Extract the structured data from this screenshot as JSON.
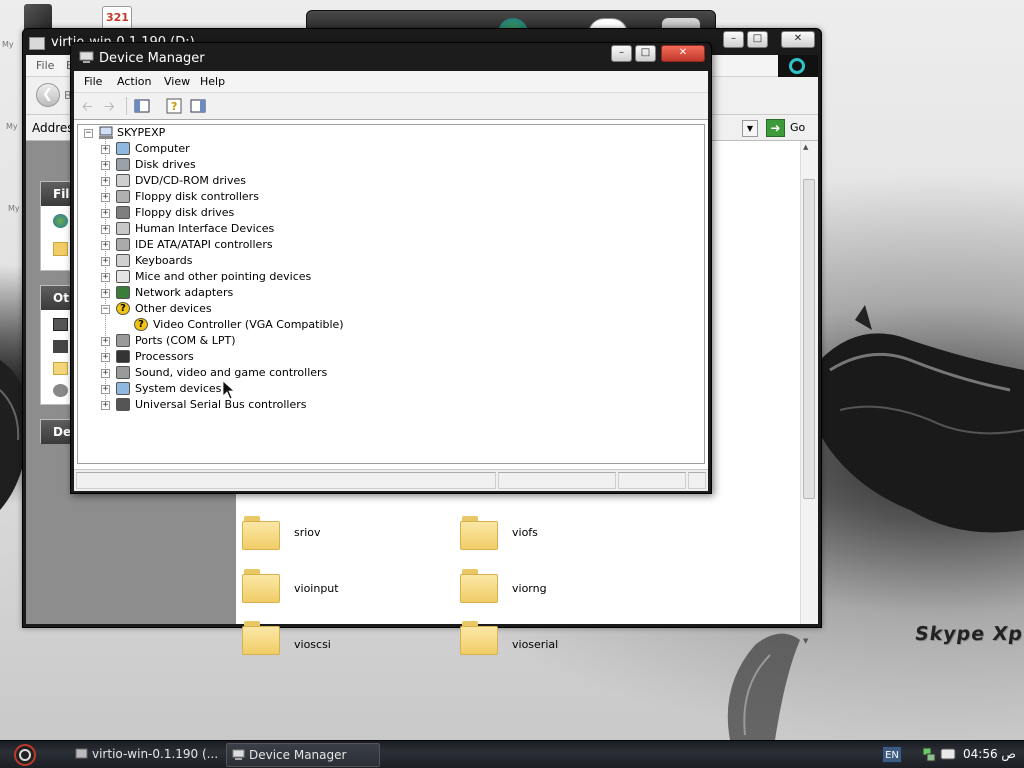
{
  "desktop": {
    "brand_text": "Skype Xp"
  },
  "explorer": {
    "title": "virtio-win-0.1.190 (D:)",
    "menu": [
      "File",
      "E"
    ],
    "back_label": "B",
    "address_label": "Address",
    "go_label": "Go",
    "task_headers": [
      "File",
      "Oth",
      "Det"
    ],
    "folders": [
      "sriov",
      "viofs",
      "vioinput",
      "viorng",
      "vioscsi",
      "vioserial"
    ]
  },
  "device_manager": {
    "title": "Device Manager",
    "menu": [
      "File",
      "Action",
      "View",
      "Help"
    ],
    "root": "SKYPEXP",
    "categories": [
      {
        "label": "Computer",
        "icon": "computer-icon",
        "expanded": false
      },
      {
        "label": "Disk drives",
        "icon": "disk-drive-icon",
        "expanded": false
      },
      {
        "label": "DVD/CD-ROM drives",
        "icon": "cdrom-icon",
        "expanded": false
      },
      {
        "label": "Floppy disk controllers",
        "icon": "floppy-controller-icon",
        "expanded": false
      },
      {
        "label": "Floppy disk drives",
        "icon": "floppy-drive-icon",
        "expanded": false
      },
      {
        "label": "Human Interface Devices",
        "icon": "hid-icon",
        "expanded": false
      },
      {
        "label": "IDE ATA/ATAPI controllers",
        "icon": "ide-controller-icon",
        "expanded": false
      },
      {
        "label": "Keyboards",
        "icon": "keyboard-icon",
        "expanded": false
      },
      {
        "label": "Mice and other pointing devices",
        "icon": "mouse-icon",
        "expanded": false
      },
      {
        "label": "Network adapters",
        "icon": "network-adapter-icon",
        "expanded": false
      },
      {
        "label": "Other devices",
        "icon": "unknown-device-icon",
        "expanded": true
      },
      {
        "label": "Video Controller (VGA Compatible)",
        "icon": "warning-device-icon",
        "child": true
      },
      {
        "label": "Ports (COM & LPT)",
        "icon": "port-icon",
        "expanded": false
      },
      {
        "label": "Processors",
        "icon": "processor-icon",
        "expanded": false
      },
      {
        "label": "Sound, video and game controllers",
        "icon": "sound-icon",
        "expanded": false
      },
      {
        "label": "System devices",
        "icon": "system-device-icon",
        "expanded": false
      },
      {
        "label": "Universal Serial Bus controllers",
        "icon": "usb-icon",
        "expanded": false
      }
    ]
  },
  "taskbar": {
    "buttons": [
      {
        "label": "virtio-win-0.1.190 (..."
      },
      {
        "label": "Device Manager",
        "active": true
      }
    ],
    "language": "EN",
    "clock": "04:56 ص"
  }
}
